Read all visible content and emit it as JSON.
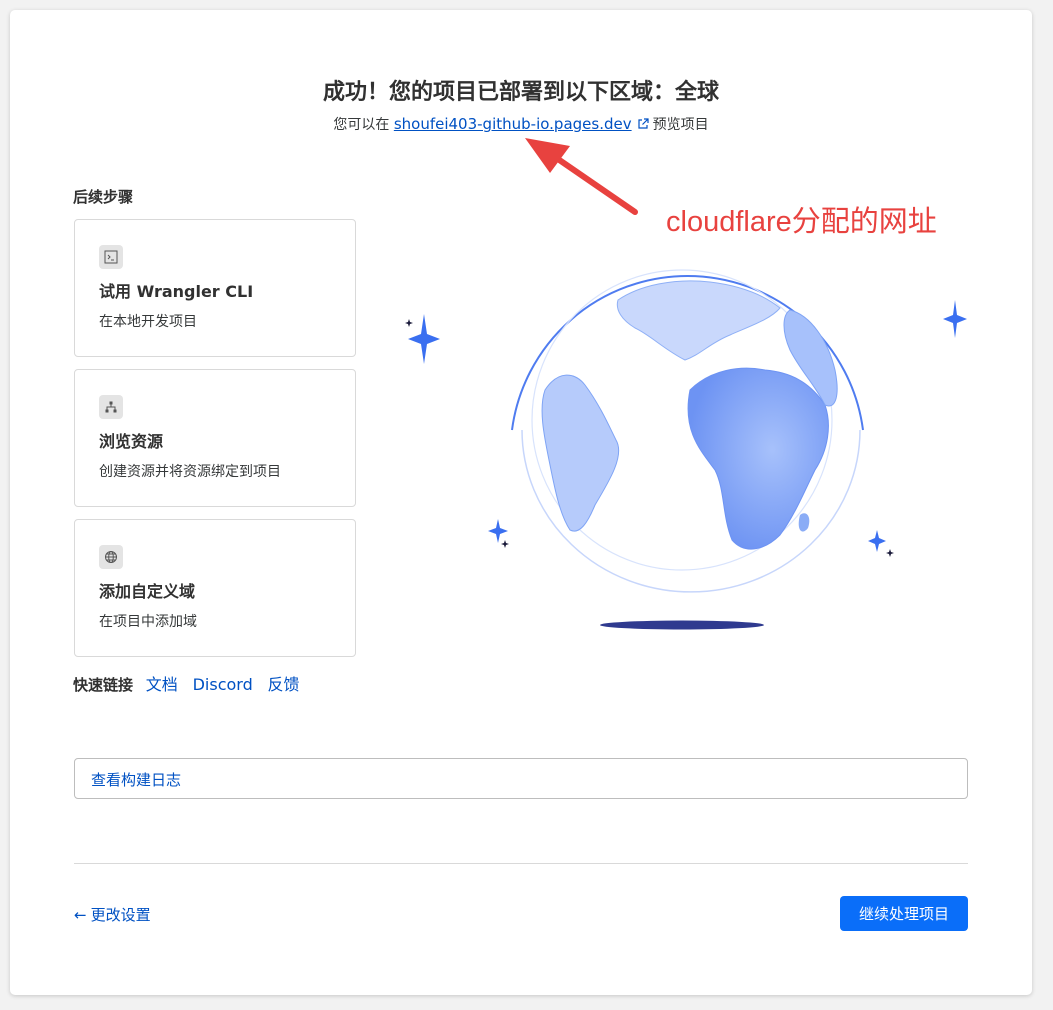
{
  "header": {
    "title": "成功！您的项目已部署到以下区域：全球",
    "subtitle_prefix": "您可以在",
    "url": "shoufei403-github-io.pages.dev",
    "subtitle_suffix": "预览项目"
  },
  "next_steps": {
    "label": "后续步骤",
    "items": [
      {
        "title": "试用 Wrangler CLI",
        "desc": "在本地开发项目",
        "icon": "terminal-icon"
      },
      {
        "title": "浏览资源",
        "desc": "创建资源并将资源绑定到项目",
        "icon": "sitemap-icon"
      },
      {
        "title": "添加自定义域",
        "desc": "在项目中添加域",
        "icon": "globe-icon"
      }
    ]
  },
  "quick_links": {
    "label": "快速链接",
    "links": [
      "文档",
      "Discord",
      "反馈"
    ]
  },
  "build_log_label": "查看构建日志",
  "footer": {
    "back_label": "更改设置",
    "continue_label": "继续处理项目"
  },
  "annotation": {
    "text": "cloudflare分配的网址",
    "color": "#e8423f"
  },
  "colors": {
    "link": "#0051c3",
    "primary": "#0a6ef9",
    "globe": "#7fa4f5",
    "star": "#3a6ff0"
  }
}
